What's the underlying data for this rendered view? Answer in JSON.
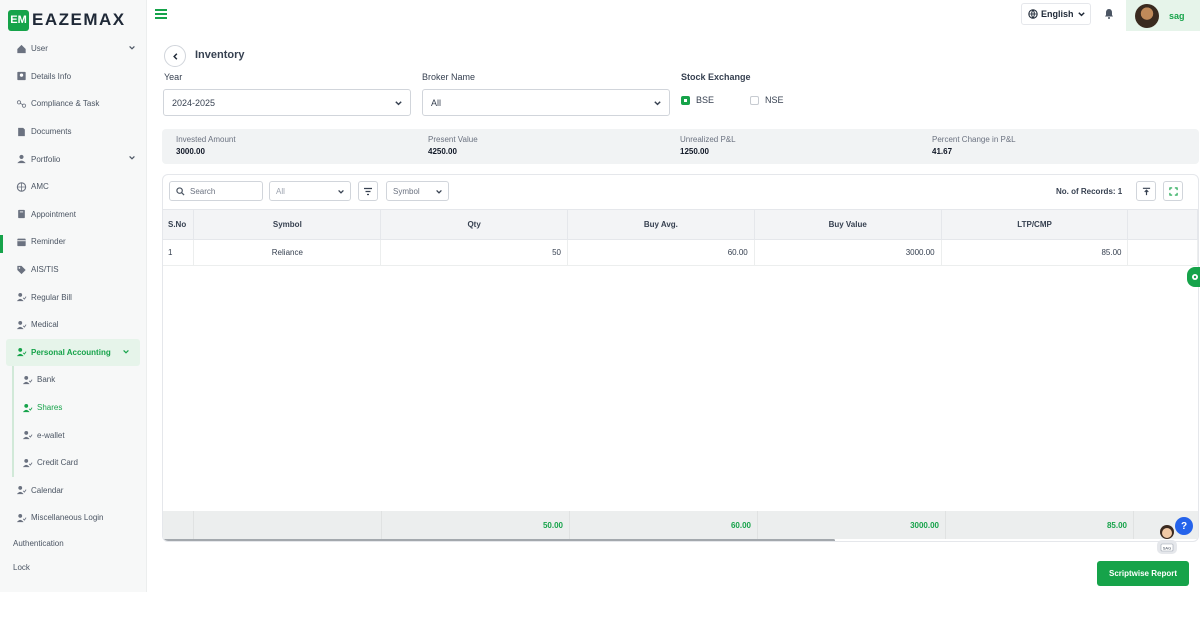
{
  "app": {
    "logo_mark": "EM",
    "logo_text": "EAZEMAX"
  },
  "sidebar": {
    "items": [
      {
        "label": "User",
        "icon": "home-icon",
        "expandable": true
      },
      {
        "label": "Details Info",
        "icon": "id-card-icon"
      },
      {
        "label": "Compliance & Task",
        "icon": "tasks-icon"
      },
      {
        "label": "Documents",
        "icon": "document-icon"
      },
      {
        "label": "Portfolio",
        "icon": "user-icon",
        "expandable": true
      },
      {
        "label": "AMC",
        "icon": "globe-icon"
      },
      {
        "label": "Appointment",
        "icon": "calendar-icon"
      },
      {
        "label": "Reminder",
        "icon": "reminder-icon"
      },
      {
        "label": "AIS/TIS",
        "icon": "tag-icon"
      },
      {
        "label": "Regular Bill",
        "icon": "user-check-icon"
      },
      {
        "label": "Medical",
        "icon": "user-check-icon"
      }
    ],
    "active_group": {
      "label": "Personal Accounting",
      "icon": "user-check-icon"
    },
    "sub_items": [
      {
        "label": "Bank"
      },
      {
        "label": "Shares",
        "current": true
      },
      {
        "label": "e-wallet"
      },
      {
        "label": "Credit Card"
      }
    ],
    "after_items": [
      {
        "label": "Calendar"
      },
      {
        "label": "Miscellaneous Login"
      }
    ],
    "plain_items": [
      {
        "label": "Authentication"
      },
      {
        "label": "Lock"
      }
    ]
  },
  "topbar": {
    "language": "English",
    "username": "sag"
  },
  "page": {
    "title": "Inventory"
  },
  "filters": {
    "year_label": "Year",
    "year_value": "2024-2025",
    "broker_label": "Broker Name",
    "broker_value": "All",
    "exchange_label": "Stock Exchange",
    "exchange_options": [
      {
        "label": "BSE",
        "checked": true
      },
      {
        "label": "NSE",
        "checked": false
      }
    ]
  },
  "summary": [
    {
      "label": "Invested Amount",
      "value": "3000.00"
    },
    {
      "label": "Present Value",
      "value": "4250.00"
    },
    {
      "label": "Unrealized P&L",
      "value": "1250.00"
    },
    {
      "label": "Percent Change in P&L",
      "value": "41.67"
    }
  ],
  "grid": {
    "search_placeholder": "Search",
    "filter_select": "All",
    "column_select": "Symbol",
    "records_label": "No. of Records: 1",
    "columns": [
      "S.No",
      "Symbol",
      "Qty",
      "Buy Avg.",
      "Buy Value",
      "LTP/CMP"
    ],
    "rows": [
      [
        "1",
        "Reliance",
        "50",
        "60.00",
        "3000.00",
        "85.00"
      ]
    ],
    "totals": [
      "",
      "",
      "50.00",
      "60.00",
      "3000.00",
      "85.00"
    ]
  },
  "actions": {
    "report_button": "Scriptwise Report"
  },
  "help": {
    "bubble": "?",
    "badge": "SAG"
  },
  "colors": {
    "brand": "#16a34a",
    "help": "#2563eb"
  }
}
